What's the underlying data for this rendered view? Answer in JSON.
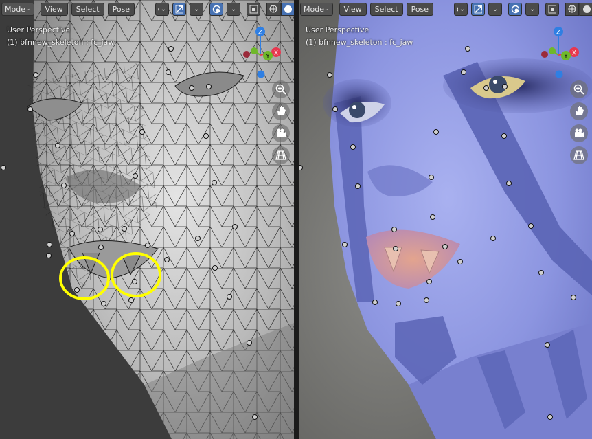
{
  "viewports": [
    {
      "header": {
        "mode_label": "Mode",
        "view_label": "View",
        "select_label": "Select",
        "pose_label": "Pose"
      },
      "info": {
        "perspective": "User Perspective",
        "object": "(1) bfnnew_skeleton : fc_jaw"
      },
      "shading": "wireframe",
      "colors": {
        "background": "#3d3d3d",
        "mesh": "#b8b8b8",
        "wire": "#161616",
        "highlight": "#ffff00"
      }
    },
    {
      "header": {
        "mode_label": "Mode",
        "view_label": "View",
        "select_label": "Select",
        "pose_label": "Pose"
      },
      "info": {
        "perspective": "User Perspective",
        "object": "(1) bfnnew_skeleton : fc_jaw"
      },
      "shading": "material",
      "colors": {
        "background": "#6a6a66",
        "skin": "#8c95e0",
        "stripe": "#5a64b5",
        "lips": "#d79a9a"
      }
    }
  ],
  "gizmo": {
    "z_label": "Z",
    "y_label": "Y",
    "x_label": "X",
    "x_color": "#e8384f",
    "y_color": "#6fb82a",
    "z_color": "#2f7fe3"
  },
  "nav_icons": [
    "zoom-icon",
    "hand-pan-icon",
    "camera-icon",
    "grid-view-icon"
  ],
  "header_icons": [
    "eye-visibility-icon",
    "gizmo-toggle-icon",
    "overlay-icon",
    "xray-icon",
    "wireframe-shading-icon",
    "solid-shading-icon",
    "material-shading-icon",
    "rendered-shading-icon"
  ]
}
